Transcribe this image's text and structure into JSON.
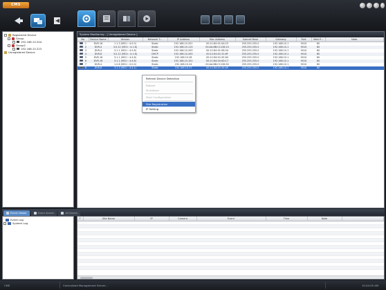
{
  "app": {
    "logo_text": "CMS"
  },
  "nav": {
    "items": [
      "home",
      "device-manager",
      "close"
    ]
  },
  "modules": [
    "device-config",
    "device-list",
    "record",
    "playback"
  ],
  "tree": {
    "root": "Registered Device",
    "group1": "Group",
    "dev1": "192.168.10.204",
    "group2": "Group2",
    "dev2": "192.168.10.223",
    "unreg": "Unregistered Device"
  },
  "main": {
    "title": "System Monitoring - [ Unregistered Device ]",
    "columns": [
      "No",
      "Device Name",
      "Version",
      "Network T...",
      "IP Address",
      "Mac Address",
      "Subnet Mask",
      "Gateway",
      "Port",
      "Web P...",
      "Note"
    ],
    "rows": [
      [
        "1",
        "DVR-16",
        "1.1.3 (MCU : 4.0.0)",
        "Static",
        "192.168.10.201",
        "00:1C:84:01:0A:23",
        "255.255.255.0",
        "192.168.10.1",
        "9010",
        "80",
        ""
      ],
      [
        "2",
        "DVR-4",
        "3.0.12 (MCU : 4.1.8)",
        "Static",
        "192.168.10.115",
        "00:AA:BB:CC:DD:10",
        "255.255.255.0",
        "192.168.10.1",
        "9010",
        "80",
        ""
      ],
      [
        "3",
        "DVR-4",
        "3.1.1 (MCU : 4.5.8)",
        "Static",
        "192.168.10.205",
        "00:1C:84:01:0B:34",
        "255.255.255.0",
        "192.168.10.1",
        "9010",
        "80",
        ""
      ],
      [
        "4",
        "DVR-8",
        "3.0.12 (MCU : 4.1.8)",
        "DHCP",
        "192.168.10.200",
        "00:1C:84:01:31:6F",
        "255.255.255.0",
        "192.168.10.1",
        "9010",
        "80",
        ""
      ],
      [
        "5",
        "DVR-16",
        "3.1.1 (MCU : 4.4.8)",
        "Static",
        "192.168.10.28",
        "00:1C:84:01:2E:84",
        "255.255.255.0",
        "192.168.10.1",
        "9010",
        "80",
        ""
      ],
      [
        "6",
        "DVR-16",
        "3.1.1 (MCU : 4.4.8)",
        "Static",
        "192.168.10.102",
        "00:1C:84:00:0D:17",
        "255.255.255.0",
        "192.168.10.1",
        "9010",
        "80",
        ""
      ],
      [
        "7",
        "DVR-4",
        "1.0.8 (MCU : 0.0.0)",
        "Static",
        "192.168.10.24",
        "00:AA:BB:CC:DD:50",
        "255.255.255.0",
        "192.168.10.1",
        "9010",
        "80",
        ""
      ],
      [
        "8",
        "DVR-8",
        "3.1.3 (MCU : 4.4.1)",
        "Static",
        "192.168.10.57",
        "00:1C:84:01:34:49",
        "255.255.255.0",
        "192.168.10.1",
        "9010",
        "80",
        ""
      ]
    ]
  },
  "context_menu": {
    "items": [
      "Refresh Device Detection",
      "Reboot",
      "Shutdown",
      "Start Configuration",
      "Site Registration",
      "IP Setting"
    ]
  },
  "bottom": {
    "tabs": [
      "Event Viewer",
      "Event Search",
      "All Search"
    ],
    "log_tree": [
      "Event Log",
      "System Log"
    ],
    "columns": [
      "T",
      "Site Name",
      "IP",
      "Camera",
      "Event",
      "Time",
      "Note"
    ]
  },
  "status": {
    "left": "CMS",
    "message": "Centralized Management Server...",
    "time": "10:44:05 AM"
  }
}
